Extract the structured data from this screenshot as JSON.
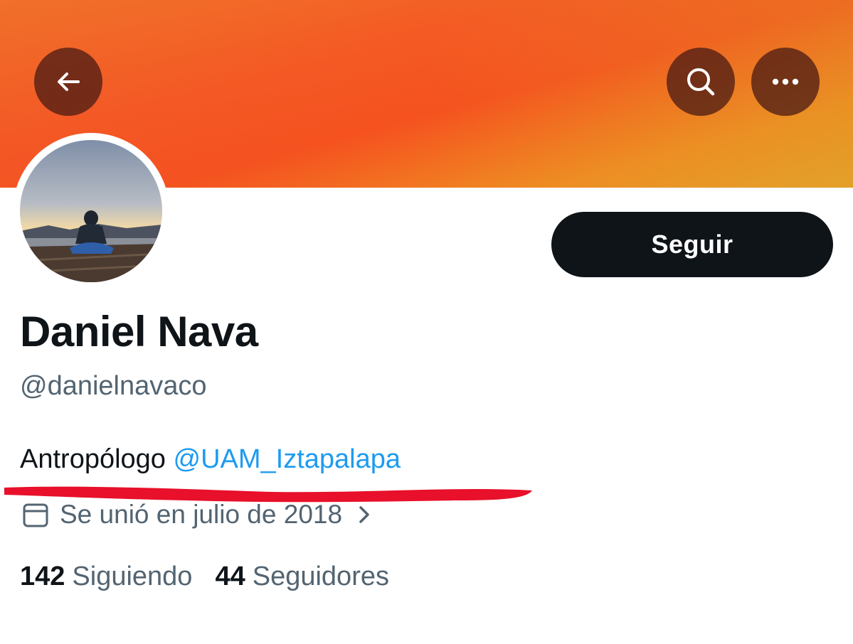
{
  "colors": {
    "banner": "#f5521f",
    "button_dark": "#0f1419",
    "text_primary": "#0f1419",
    "text_secondary": "#536471",
    "mention": "#1d9bf0",
    "highlight_stroke": "#e8102a"
  },
  "top_bar": {
    "back_icon": "arrow-left-icon",
    "search_icon": "search-icon",
    "more_icon": "more-horizontal-icon"
  },
  "profile": {
    "follow_label": "Seguir",
    "display_name": "Daniel Nava",
    "handle": "@danielnavaco",
    "bio_text": "Antropólogo ",
    "bio_mention": "@UAM_Iztapalapa",
    "joined": "Se unió en julio de 2018",
    "joined_icon": "calendar-icon",
    "following_count": "142",
    "following_label": "Siguiendo",
    "followers_count": "44",
    "followers_label": "Seguidores"
  }
}
